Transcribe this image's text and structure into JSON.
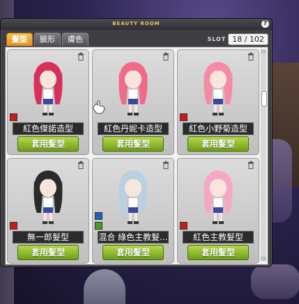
{
  "window": {
    "title": "BEAUTY ROOM",
    "close_label": "?"
  },
  "tabs": [
    {
      "label": "髮型"
    },
    {
      "label": "臉形"
    },
    {
      "label": "膚色"
    }
  ],
  "slot": {
    "label": "SLOT",
    "value": "18 / 102"
  },
  "apply_label": "套用髮型",
  "cards": [
    {
      "name": "紅色傑諾造型",
      "hair_color": "#d8305a",
      "swatches": [
        "#d01818"
      ]
    },
    {
      "name": "紅色丹妮卡造型",
      "hair_color": "#f06a8a",
      "swatches": []
    },
    {
      "name": "紅色小野菊造型",
      "hair_color": "#f48aa4",
      "swatches": [
        "#d01818"
      ]
    },
    {
      "name": "無一郎髮型",
      "hair_color": "#2a2a2a",
      "swatches": [
        "#d01818"
      ]
    },
    {
      "name": "混合 綠色主教髮...",
      "hair_color": "#b8d0e0",
      "swatches": [
        "#2060c0",
        "#40a020"
      ]
    },
    {
      "name": "紅色主教髮型",
      "hair_color": "#f4a8c4",
      "swatches": [
        "#d01818"
      ]
    }
  ]
}
